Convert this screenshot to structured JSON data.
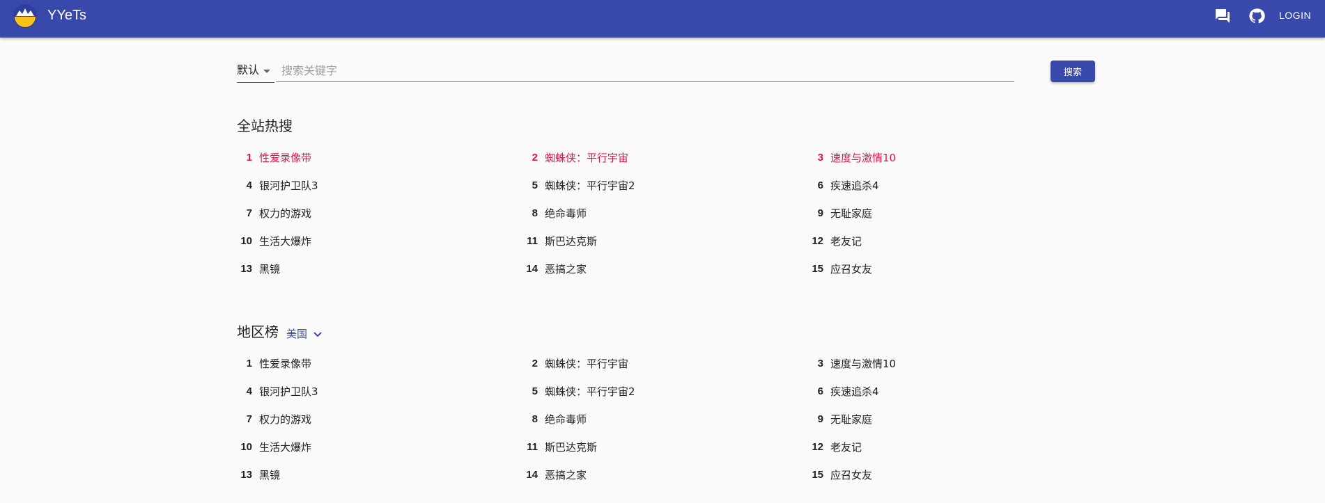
{
  "app": {
    "title": "YYeTs",
    "login_label": "LOGIN",
    "accent_color": "#3949ab",
    "hot_color": "#e0144c",
    "icons": [
      "logo-icon",
      "chat-icon",
      "github-icon"
    ]
  },
  "search": {
    "category_value": "默认",
    "placeholder": "搜索关键字",
    "value": "",
    "button_label": "搜索"
  },
  "hot": {
    "title": "全站热搜",
    "items": [
      {
        "rank": "1",
        "name": "性爱录像带"
      },
      {
        "rank": "2",
        "name": "蜘蛛侠：平行宇宙"
      },
      {
        "rank": "3",
        "name": "速度与激情10"
      },
      {
        "rank": "4",
        "name": "银河护卫队3"
      },
      {
        "rank": "5",
        "name": "蜘蛛侠：平行宇宙2"
      },
      {
        "rank": "6",
        "name": "疾速追杀4"
      },
      {
        "rank": "7",
        "name": "权力的游戏"
      },
      {
        "rank": "8",
        "name": "绝命毒师"
      },
      {
        "rank": "9",
        "name": "无耻家庭"
      },
      {
        "rank": "10",
        "name": "生活大爆炸"
      },
      {
        "rank": "11",
        "name": "斯巴达克斯"
      },
      {
        "rank": "12",
        "name": "老友记"
      },
      {
        "rank": "13",
        "name": "黑镜"
      },
      {
        "rank": "14",
        "name": "恶搞之家"
      },
      {
        "rank": "15",
        "name": "应召女友"
      }
    ]
  },
  "region": {
    "title": "地区榜",
    "selected_region": "美国",
    "items": [
      {
        "rank": "1",
        "name": "性爱录像带"
      },
      {
        "rank": "2",
        "name": "蜘蛛侠：平行宇宙"
      },
      {
        "rank": "3",
        "name": "速度与激情10"
      },
      {
        "rank": "4",
        "name": "银河护卫队3"
      },
      {
        "rank": "5",
        "name": "蜘蛛侠：平行宇宙2"
      },
      {
        "rank": "6",
        "name": "疾速追杀4"
      },
      {
        "rank": "7",
        "name": "权力的游戏"
      },
      {
        "rank": "8",
        "name": "绝命毒师"
      },
      {
        "rank": "9",
        "name": "无耻家庭"
      },
      {
        "rank": "10",
        "name": "生活大爆炸"
      },
      {
        "rank": "11",
        "name": "斯巴达克斯"
      },
      {
        "rank": "12",
        "name": "老友记"
      },
      {
        "rank": "13",
        "name": "黑镜"
      },
      {
        "rank": "14",
        "name": "恶搞之家"
      },
      {
        "rank": "15",
        "name": "应召女友"
      }
    ]
  }
}
